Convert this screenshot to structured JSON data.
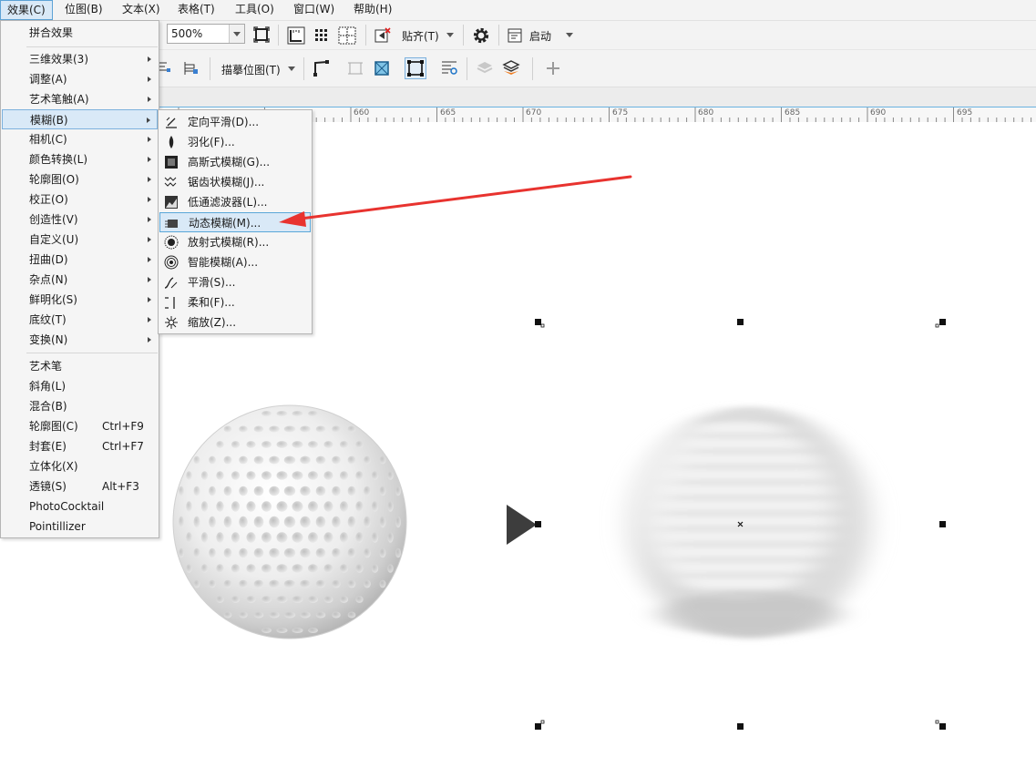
{
  "menubar": {
    "items": [
      {
        "label": "效果(C)",
        "active": true
      },
      {
        "label": "位图(B)"
      },
      {
        "label": "文本(X)"
      },
      {
        "label": "表格(T)"
      },
      {
        "label": "工具(O)"
      },
      {
        "label": "窗口(W)"
      },
      {
        "label": "帮助(H)"
      }
    ]
  },
  "toolbar": {
    "zoom_value": "500%",
    "snap_label": "贴齐(T)",
    "launch_label": "启动",
    "trace_bitmap_label": "描摹位图(T)"
  },
  "ruler": {
    "labels": [
      "660",
      "665",
      "670",
      "675",
      "680",
      "685",
      "690",
      "695"
    ]
  },
  "effects_menu": {
    "top_item": "拼合效果",
    "submenu_items": [
      "三维效果(3)",
      "调整(A)",
      "艺术笔触(A)",
      "模糊(B)",
      "相机(C)",
      "颜色转换(L)",
      "轮廓图(O)",
      "校正(O)",
      "创造性(V)",
      "自定义(U)",
      "扭曲(D)",
      "杂点(N)",
      "鲜明化(S)",
      "底纹(T)",
      "变换(N)"
    ],
    "highlighted_index": 3,
    "bottom_items": [
      {
        "label": "艺术笔",
        "shortcut": ""
      },
      {
        "label": "斜角(L)",
        "shortcut": ""
      },
      {
        "label": "混合(B)",
        "shortcut": ""
      },
      {
        "label": "轮廓图(C)",
        "shortcut": "Ctrl+F9"
      },
      {
        "label": "封套(E)",
        "shortcut": "Ctrl+F7"
      },
      {
        "label": "立体化(X)",
        "shortcut": ""
      },
      {
        "label": "透镜(S)",
        "shortcut": "Alt+F3"
      },
      {
        "label": "PhotoCocktail",
        "shortcut": ""
      },
      {
        "label": "Pointillizer",
        "shortcut": ""
      }
    ]
  },
  "blur_menu": {
    "items": [
      {
        "label": "定向平滑(D)...",
        "icon": "directional-smooth-icon"
      },
      {
        "label": "羽化(F)...",
        "icon": "feather-icon"
      },
      {
        "label": "高斯式模糊(G)...",
        "icon": "gaussian-blur-icon"
      },
      {
        "label": "锯齿状模糊(J)...",
        "icon": "jaggy-blur-icon"
      },
      {
        "label": "低通滤波器(L)...",
        "icon": "low-pass-filter-icon"
      },
      {
        "label": "动态模糊(M)...",
        "icon": "motion-blur-icon"
      },
      {
        "label": "放射式模糊(R)...",
        "icon": "radial-blur-icon"
      },
      {
        "label": "智能模糊(A)...",
        "icon": "smart-blur-icon"
      },
      {
        "label": "平滑(S)...",
        "icon": "smooth-icon"
      },
      {
        "label": "柔和(F)...",
        "icon": "soften-icon"
      },
      {
        "label": "缩放(Z)...",
        "icon": "zoom-blur-icon"
      }
    ],
    "highlighted_index": 5
  },
  "colors": {
    "accent": "#5ea3d6",
    "highlight_bg": "#d9e9f7",
    "annotation_arrow": "#e8332f"
  }
}
